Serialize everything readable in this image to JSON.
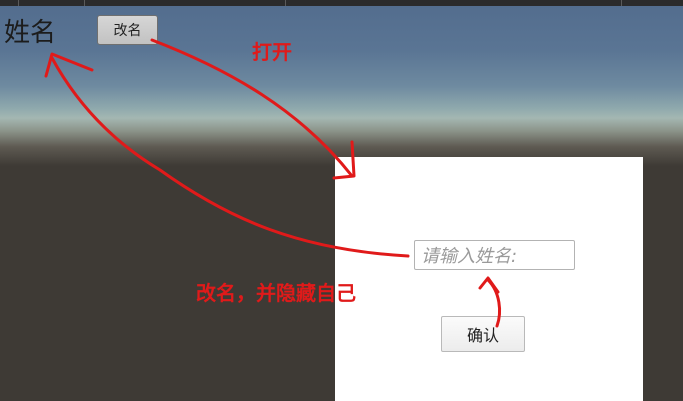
{
  "scene": {
    "name_label": "姓名",
    "rename_button_label": "改名"
  },
  "dialog": {
    "name_input_placeholder": "请输入姓名:",
    "confirm_button_label": "确认"
  },
  "annotations": {
    "open_label": "打开",
    "rename_hide_label": "改名，并隐藏自己",
    "arrow_color": "#e01a1a"
  }
}
